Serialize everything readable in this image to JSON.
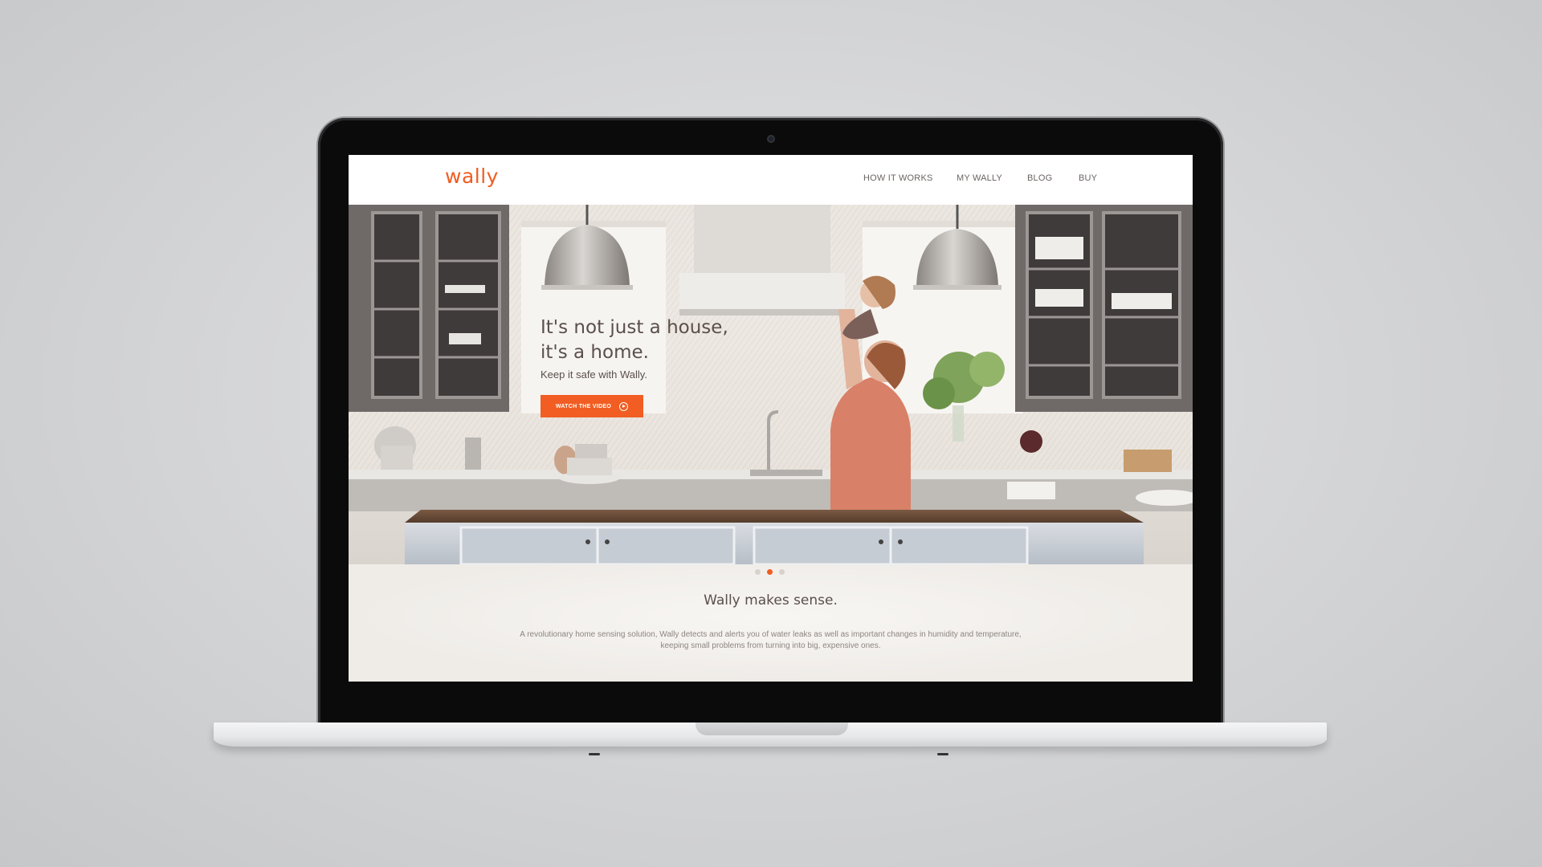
{
  "site": {
    "logo": "wally",
    "brand_color": "#f15d22",
    "nav": [
      {
        "label": "HOW IT WORKS"
      },
      {
        "label": "MY WALLY"
      },
      {
        "label": "BLOG"
      },
      {
        "label": "BUY"
      }
    ]
  },
  "hero": {
    "title": "It's not just a house, it's a home.",
    "subtitle": "Keep it safe with Wally.",
    "button_label": "WATCH THE VIDEO",
    "button_icon": "play-circle-icon",
    "carousel": {
      "slides": 3,
      "active_slide": 2
    }
  },
  "intro": {
    "title": "Wally makes sense.",
    "text": "A revolutionary home sensing solution, Wally detects and alerts you of water leaks as well as important changes in humidity and temperature, keeping small problems from turning into big, expensive ones."
  }
}
